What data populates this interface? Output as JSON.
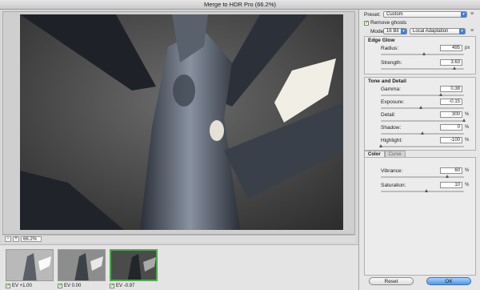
{
  "window": {
    "title": "Merge to HDR Pro (66.2%)"
  },
  "zoom": {
    "minus": "-",
    "plus": "+",
    "value": "66.2%"
  },
  "thumbnails": [
    {
      "label": "EV +1.00",
      "checked": true,
      "selected": false
    },
    {
      "label": "EV 0.00",
      "checked": true,
      "selected": false
    },
    {
      "label": "EV -0.97",
      "checked": true,
      "selected": true
    }
  ],
  "settings": {
    "preset_label": "Preset:",
    "preset_value": "Custom",
    "remove_ghosts_label": "Remove ghosts",
    "remove_ghosts_checked": true,
    "mode_label": "Mode:",
    "mode_bits": "16 Bit",
    "mode_method": "Local Adaptation",
    "menu_glyph": "≡"
  },
  "edge_glow": {
    "title": "Edge Glow",
    "params": [
      {
        "label": "Radius:",
        "value": "495",
        "unit": "px",
        "level": 0.52
      },
      {
        "label": "Strength:",
        "value": "3.63",
        "unit": "",
        "level": 0.88
      }
    ]
  },
  "tone_detail": {
    "title": "Tone and Detail",
    "params": [
      {
        "label": "Gamma:",
        "value": "0.38",
        "unit": "",
        "level": 0.72
      },
      {
        "label": "Exposure:",
        "value": "-0.15",
        "unit": "",
        "level": 0.48
      },
      {
        "label": "Detail:",
        "value": "300",
        "unit": "%",
        "level": 1.0
      },
      {
        "label": "Shadow:",
        "value": "0",
        "unit": "%",
        "level": 0.5
      },
      {
        "label": "Highlight:",
        "value": "-100",
        "unit": "%",
        "level": 0.0
      }
    ]
  },
  "color_tabs": [
    {
      "label": "Color",
      "active": true
    },
    {
      "label": "Curve",
      "active": false
    }
  ],
  "color": {
    "params": [
      {
        "label": "Vibrance:",
        "value": "60",
        "unit": "%",
        "level": 0.8
      },
      {
        "label": "Saturation:",
        "value": "10",
        "unit": "%",
        "level": 0.55
      }
    ]
  },
  "buttons": {
    "reset": "Reset",
    "ok": "OK"
  },
  "colors": {
    "ok_button": "#4d97ec",
    "selected_thumb": "#4fa94a"
  }
}
